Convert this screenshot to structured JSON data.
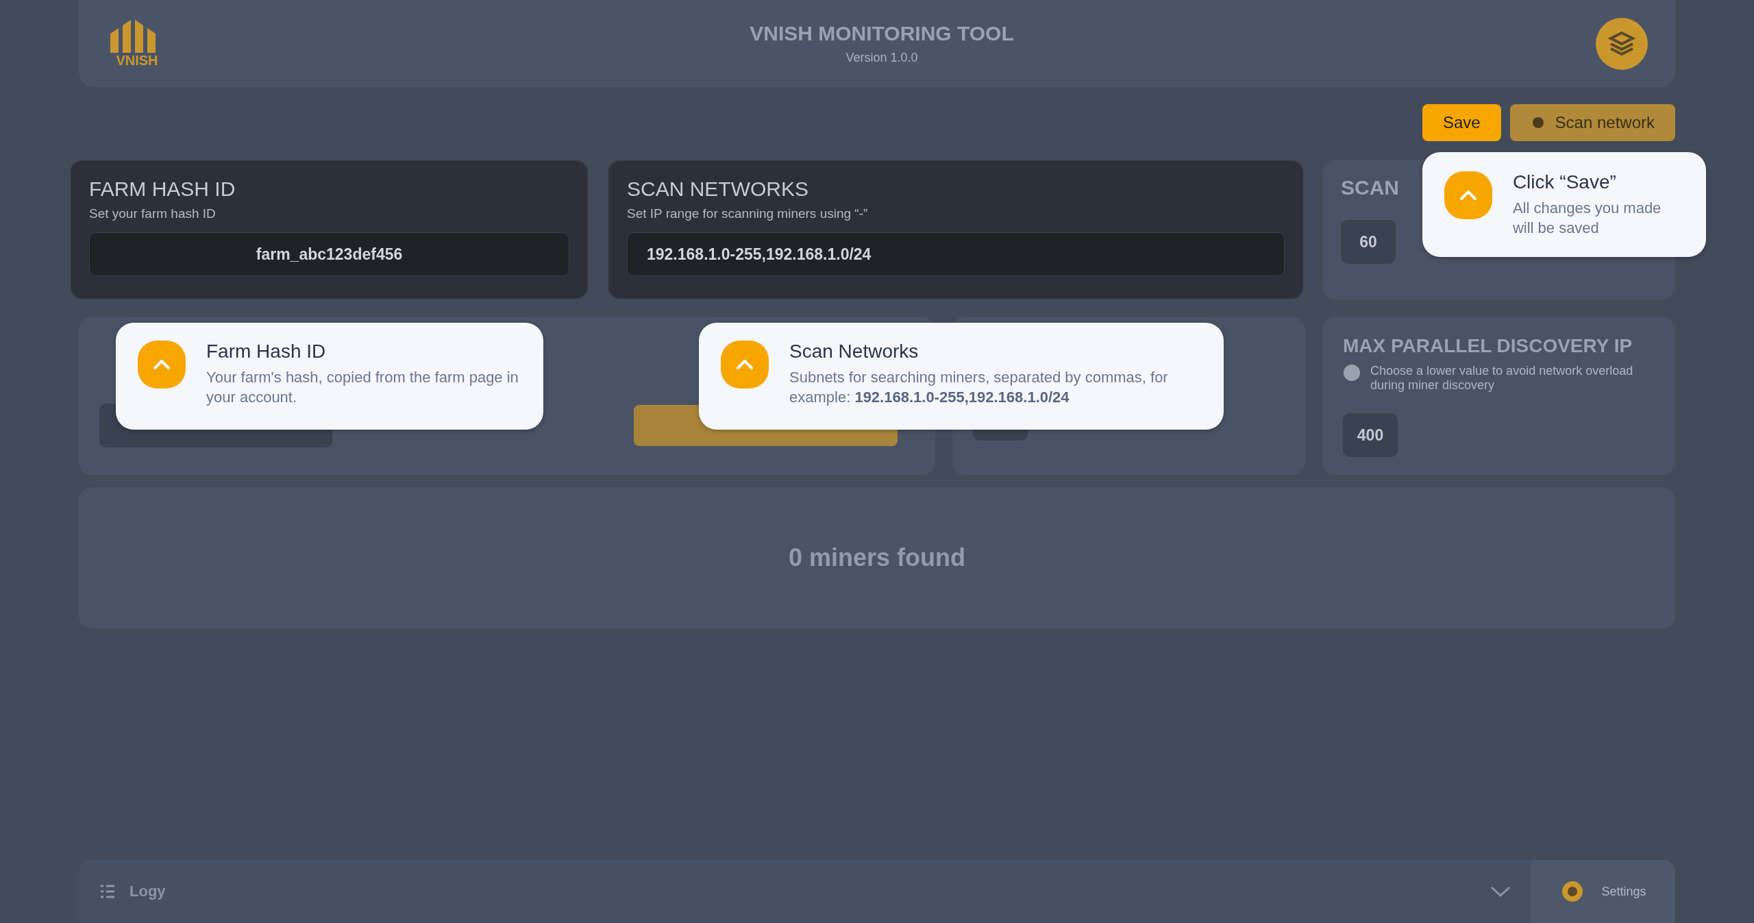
{
  "header": {
    "logo_text": "VNISH",
    "title": "VNISH MONITORING TOOL",
    "version": "Version 1.0.0"
  },
  "actions": [
    {
      "label": "Save",
      "spotlit": true,
      "tooltip": {
        "title": "Click “Save”",
        "text": "All changes you made will be saved"
      }
    },
    {
      "label": "Scan network",
      "spotlit": false
    }
  ],
  "top_cards": [
    {
      "title": "FARM HASH ID",
      "subtitle": "Set your farm hash ID",
      "value": "farm_abc123def456",
      "kind": "hash",
      "spotlit": true,
      "tooltip": {
        "title": "Farm Hash ID",
        "text": "Your farm's hash, copied from the farm page in your account."
      }
    },
    {
      "title": "SCAN NETWORKS",
      "subtitle": "Set IP range for scanning miners using “-”",
      "value": "192.168.1.0-255,192.168.1.0/24",
      "kind": "networks",
      "spotlit": true,
      "tooltip": {
        "title": "Scan Networks",
        "text": "Subnets for searching miners, separated by commas, for example: **192.168.1.0-255,192.168.1.0/24**"
      }
    },
    {
      "title": "SCAN",
      "value": "60",
      "kind": "interval",
      "spotlit": false
    }
  ],
  "bottom_cards": [
    {
      "kind": "update",
      "spotlit": false
    },
    {
      "kind": "field",
      "spotlit": false
    },
    {
      "kind": "field",
      "title": "MAX PARALLEL DISCOVERY IP",
      "hint": "Choose a lower value to avoid network overload during miner discovery",
      "value": "400",
      "spotlit": false
    }
  ],
  "results": {
    "empty_text": "0 miners found"
  },
  "footer": {
    "logs_label": "Logy",
    "settings_label": "Settings"
  }
}
